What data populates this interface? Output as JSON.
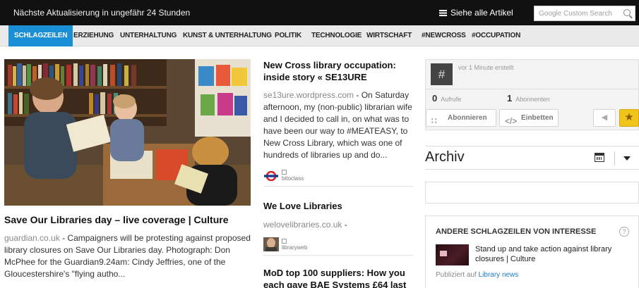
{
  "topbar": {
    "update_text": "Nächste Aktualisierung in ungefähr 24 Stunden",
    "all_articles": "Siehe alle Artikel",
    "search_placeholder": "Google Custom Search"
  },
  "nav": {
    "tabs": [
      {
        "label": "SCHLAGZEILEN",
        "active": true
      },
      {
        "label": "ERZIEHUNG"
      },
      {
        "label": "UNTERHALTUNG"
      },
      {
        "label": "KUNST & UNTERHALTUNG"
      },
      {
        "label": "POLITIK"
      },
      {
        "label": "TECHNOLOGIE"
      },
      {
        "label": "WIRTSCHAFT"
      },
      {
        "label": "#NEWCROSS"
      },
      {
        "label": "#OCCUPATION"
      }
    ]
  },
  "featured": {
    "title": "Save Our Libraries day – live coverage | Culture",
    "source": "guardian.co.uk",
    "text": " - Campaigners will be protesting against proposed library closures on Save Our Libraries day. Photograph: Don McPhee for the Guardian9.24am: Cindy Jeffries, one of the Gloucestershire's \"flying autho..."
  },
  "articles": [
    {
      "title": "New Cross library occupation: inside story « SE13URE",
      "source": "se13ure.wordpress.com",
      "text": " - On Saturday afternoon, my (non-public) librarian wife and I decided to call in, on what was to have been our way to #MEATEASY, to New Cross Library, which was one of hundreds of libraries up and do...",
      "credit": "bitoclass"
    },
    {
      "title": "We Love Libraries",
      "source": "welovelibraries.co.uk",
      "text": " -",
      "credit": "libraryweb"
    },
    {
      "title": "MoD top 100 suppliers: How you each gave BAE Systems £64 last"
    }
  ],
  "sidebar": {
    "hash_symbol": "#",
    "created": "vor 1 Minute erstellt",
    "views_count": "0",
    "views_label": "Aufrufe",
    "followers_count": "1",
    "followers_label": "Abonnenten",
    "follow_btn": "Abonnieren",
    "embed_btn": "Einbetten",
    "archive_title": "Archiv",
    "other_headlines_title": "ANDERE SCHLAGZEILEN VON INTERESSE",
    "other_item_title": "Stand up and take action against library closures | Culture",
    "published_prefix": "Publiziert auf",
    "published_link": "Library news"
  },
  "colors": {
    "topbar_bg": "#111111",
    "nav_active": "#1a8fd6",
    "star_button": "#f0c419",
    "link": "#1a7cc4"
  }
}
